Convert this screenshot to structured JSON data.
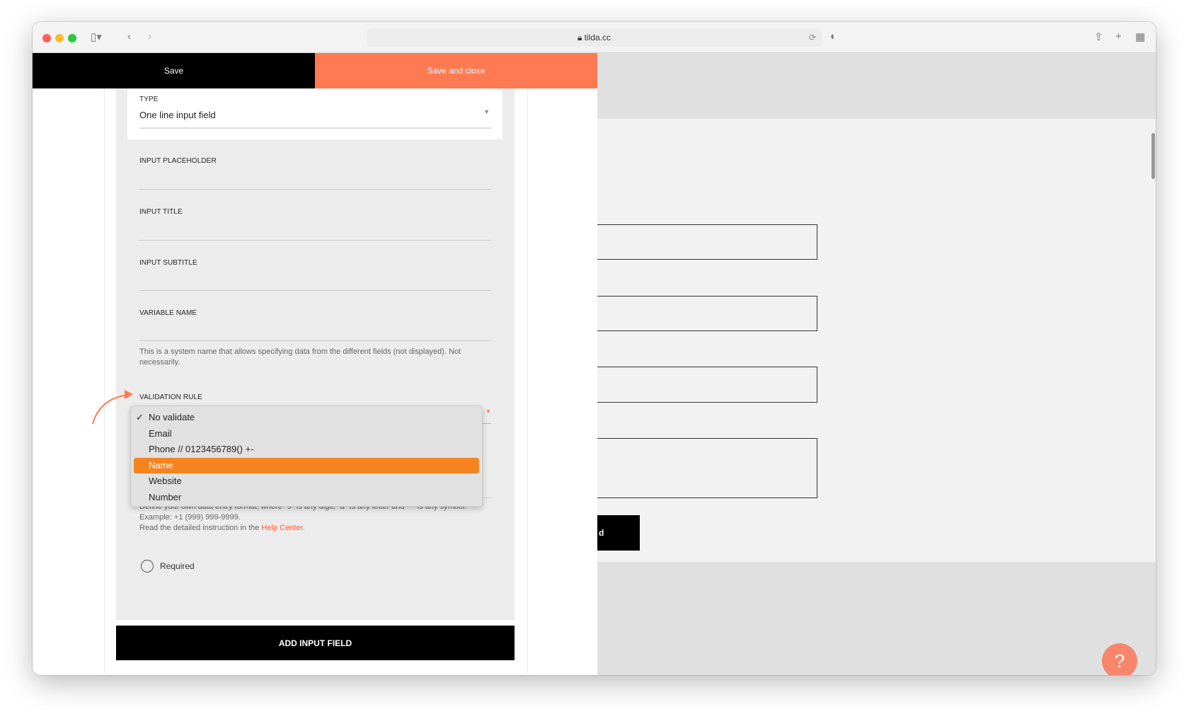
{
  "browser": {
    "url": "tilda.cc"
  },
  "toolbar": {
    "save_label": "Save",
    "save_close_label": "Save and close"
  },
  "form": {
    "type_label": "TYPE",
    "type_value": "One line input field",
    "placeholder_label": "INPUT PLACEHOLDER",
    "title_label": "INPUT TITLE",
    "subtitle_label": "INPUT SUBTITLE",
    "variable_label": "VARIABLE NAME",
    "variable_hint": "This is a system name that allows specifying data from the different fields (not displayed). Not necessarily.",
    "validation_label": "VALIDATION RULE",
    "validation_options": [
      "No validate",
      "Email",
      "Phone // 0123456789() +-",
      "Name",
      "Website",
      "Number"
    ],
    "validation_selected": "No validate",
    "validation_highlighted": "Name",
    "mask_hint_1": "Define your own data entry format, where \"9\" is any digit, \"a\" is any letter and \"*\" is any symbol.",
    "mask_hint_2": "Example: +1 (999) 999-9999.",
    "mask_hint_3_prefix": "Read the detailed instruction in the ",
    "help_center_link": "Help Center",
    "mask_hint_3_suffix": ".",
    "required_label": "Required",
    "add_button": "ADD INPUT FIELD"
  },
  "preview": {
    "button_fragment": "d",
    "help_icon": "?"
  },
  "colors": {
    "accent": "#ff7a52",
    "highlight": "#f5841f",
    "black": "#000000"
  }
}
